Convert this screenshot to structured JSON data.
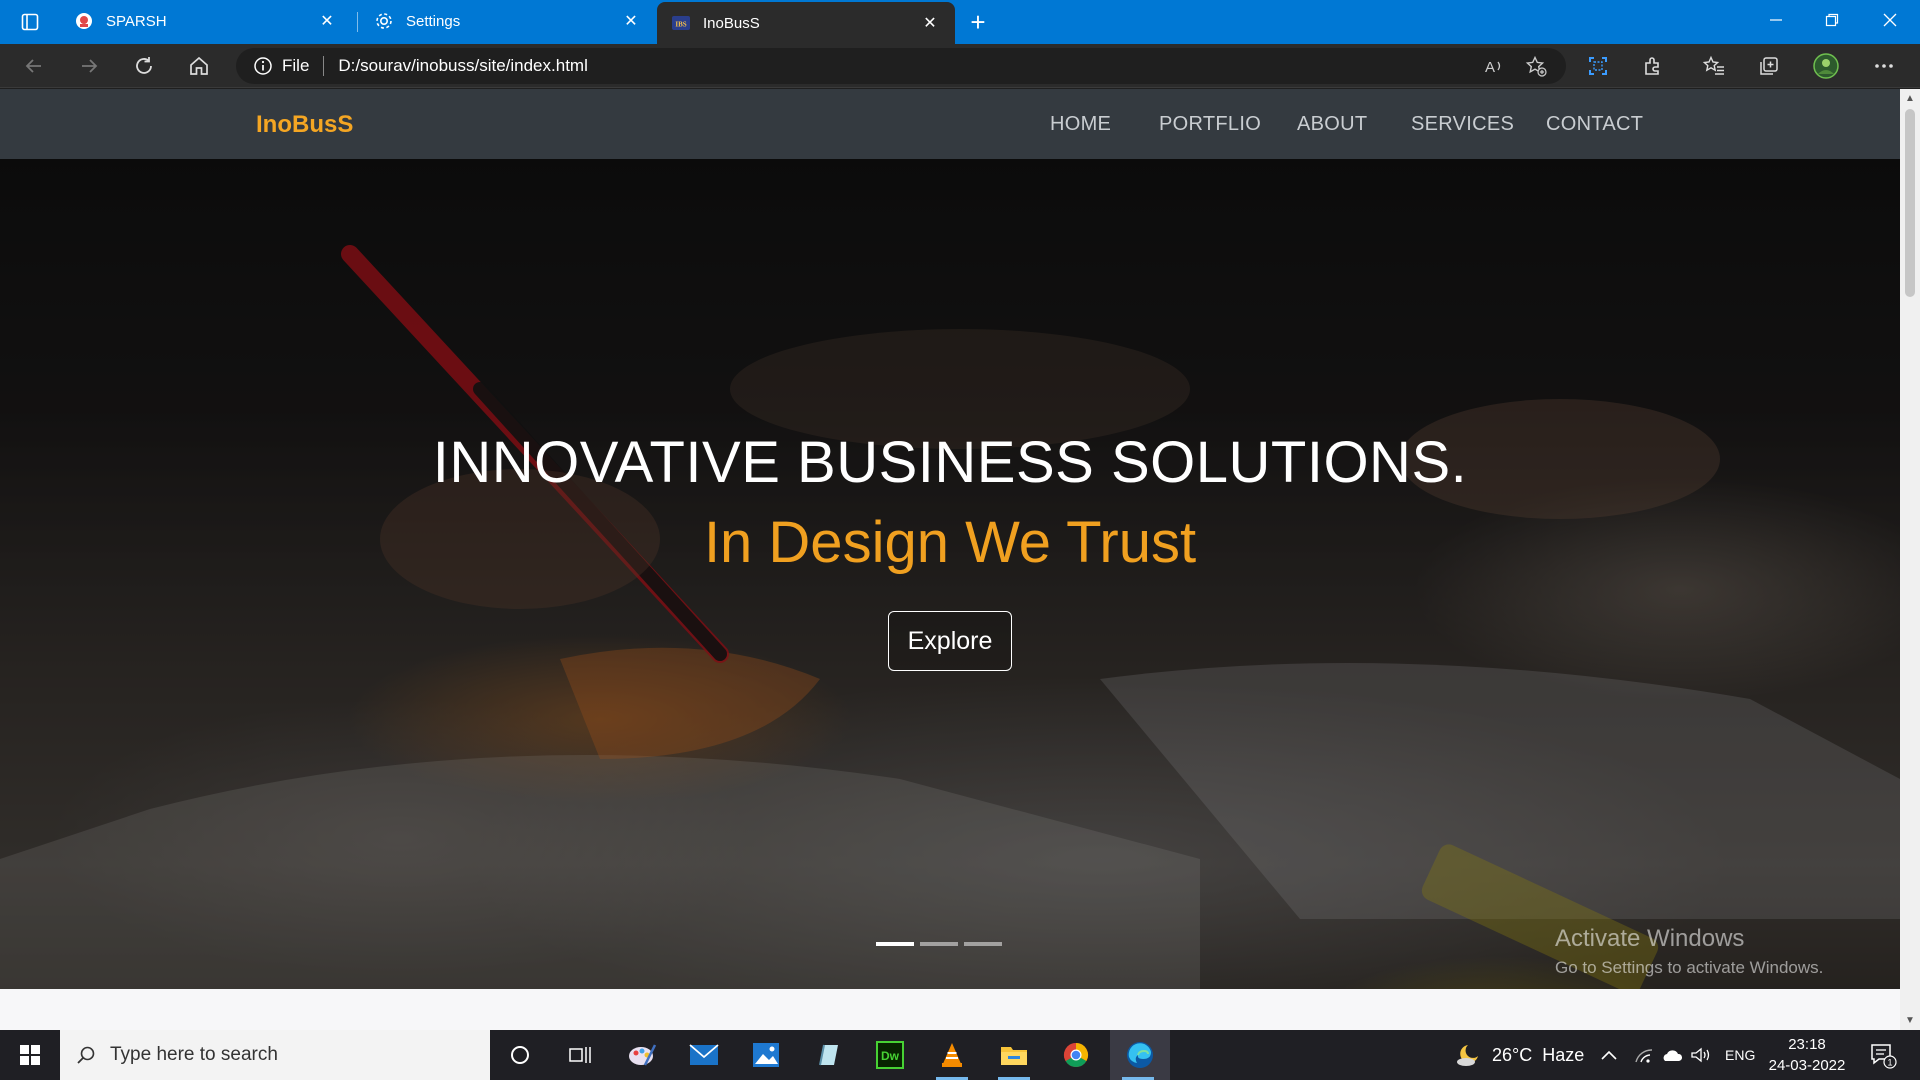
{
  "browser": {
    "tabs": [
      {
        "title": "SPARSH",
        "icon": "sparsh-icon"
      },
      {
        "title": "Settings",
        "icon": "gear-icon"
      },
      {
        "title": "InoBusS",
        "icon": "ibs-icon",
        "active": true
      }
    ],
    "address": {
      "scheme": "File",
      "url": "D:/sourav/inobuss/site/index.html"
    },
    "accent": "#0078d4"
  },
  "site": {
    "brand": "InoBusS",
    "nav": [
      "HOME",
      "PORTFLIO",
      "ABOUT",
      "SERVICES",
      "CONTACT"
    ],
    "hero": {
      "title": "INNOVATIVE BUSINESS SOLUTIONS.",
      "subtitle": "In Design We Trust",
      "cta": "Explore",
      "slides": 3,
      "active_slide": 0
    },
    "brand_color": "#f5a623",
    "subtitle_color": "#f0a020"
  },
  "watermark": {
    "line1": "Activate Windows",
    "line2": "Go to Settings to activate Windows."
  },
  "taskbar": {
    "search_placeholder": "Type here to search",
    "weather": "26°C  Haze",
    "language": "ENG",
    "time": "23:18",
    "date": "24-03-2022",
    "notifications": "1"
  }
}
